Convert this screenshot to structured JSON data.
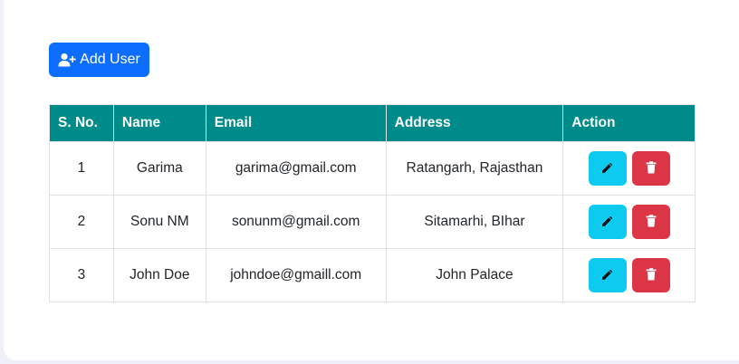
{
  "toolbar": {
    "add_user_label": "Add User",
    "add_user_icon": "user-plus-icon",
    "accent_color": "#0d6efd"
  },
  "table": {
    "header_color": "#008b8b",
    "columns": [
      "S. No.",
      "Name",
      "Email",
      "Address",
      "Action"
    ],
    "rows": [
      {
        "sno": "1",
        "name": "Garima",
        "email": "garima@gmail.com",
        "address": "Ratangarh, Rajasthan"
      },
      {
        "sno": "2",
        "name": "Sonu NM",
        "email": "sonunm@gmail.com",
        "address": "Sitamarhi, BIhar"
      },
      {
        "sno": "3",
        "name": "John Doe",
        "email": "johndoe@gmaill.com",
        "address": "John Palace"
      }
    ],
    "actions": {
      "edit_icon": "pencil-icon",
      "edit_color": "#0dcaf0",
      "delete_icon": "trash-icon",
      "delete_color": "#dc3545"
    }
  }
}
